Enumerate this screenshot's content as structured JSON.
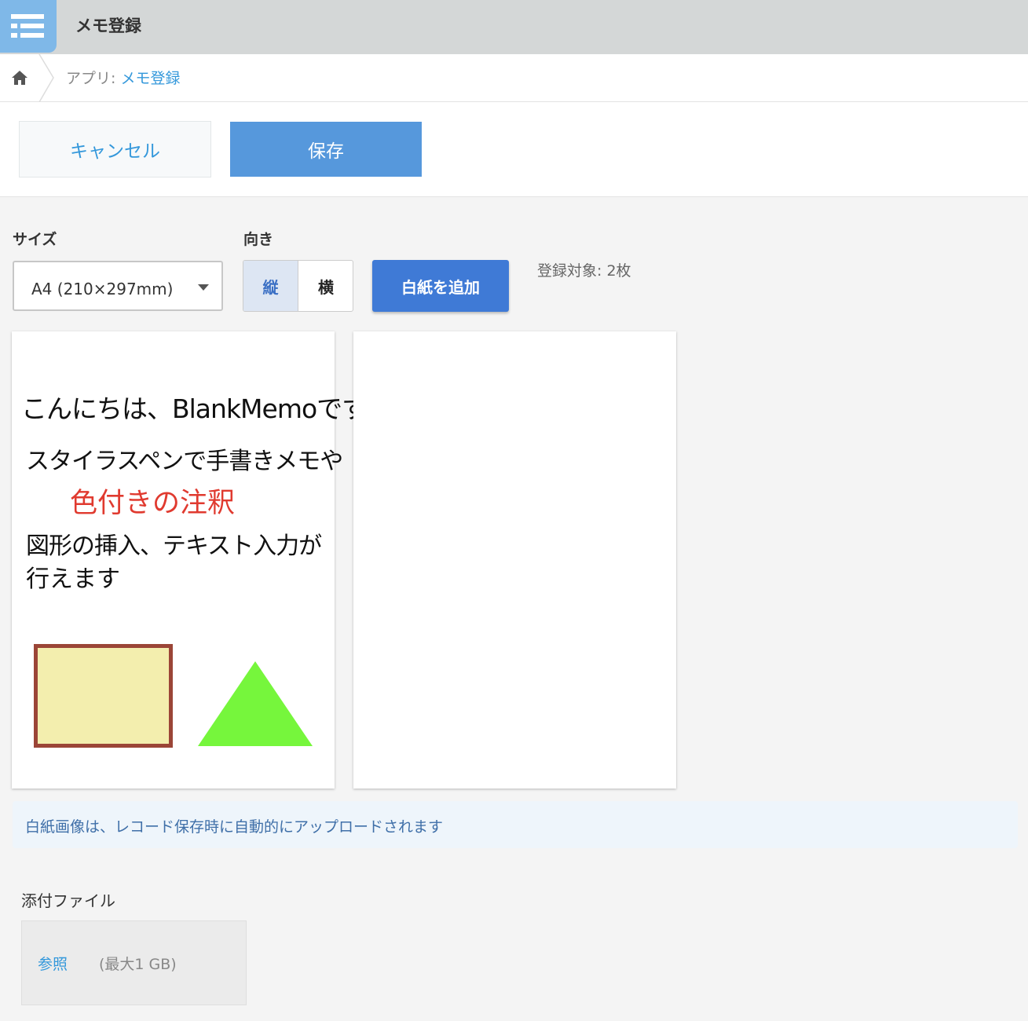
{
  "header": {
    "app_title": "メモ登録",
    "icon": "list-icon"
  },
  "breadcrumb": {
    "home_icon": "home-icon",
    "prefix": "アプリ: ",
    "app_link": "メモ登録"
  },
  "actions": {
    "cancel_label": "キャンセル",
    "save_label": "保存"
  },
  "form": {
    "size_label": "サイズ",
    "size_value": "A4 (210×297mm)",
    "orientation_label": "向き",
    "orientation_options": [
      "縦",
      "横"
    ],
    "orientation_selected": "縦",
    "add_blank_label": "白紙を追加",
    "target_count": "登録対象: 2枚"
  },
  "sheets": [
    {
      "lines": [
        "こんにちは、BlankMemoです",
        "スタイラスペンで手書きメモや",
        "色付きの注釈",
        "図形の挿入、テキスト入力が",
        "行えます"
      ],
      "annotation_color": "#e03a2f",
      "rect_fill": "#f3eeae",
      "rect_border": "#9b4537",
      "triangle_fill": "#76f63c"
    },
    {
      "lines": []
    }
  ],
  "notice": "白紙画像は、レコード保存時に自動的にアップロードされます",
  "attachment": {
    "label": "添付ファイル",
    "browse_label": "参照",
    "limit_text": "(最大1 GB)"
  },
  "colors": {
    "accent": "#3498db",
    "save_button": "#5698dc",
    "add_button": "#3f7ad6"
  }
}
